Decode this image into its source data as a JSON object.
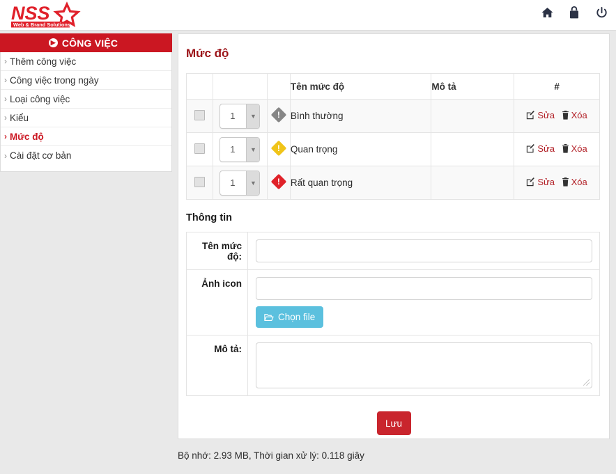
{
  "brand": {
    "name": "NSS",
    "tagline": "Web & Brand Solutions",
    "color": "#e0202a"
  },
  "topbar": {
    "icons": [
      {
        "name": "home-icon",
        "label": "Home"
      },
      {
        "name": "lock-icon",
        "label": "Lock"
      },
      {
        "name": "power-icon",
        "label": "Logout"
      }
    ]
  },
  "sidebar": {
    "header": "CÔNG VIỆC",
    "header_bg": "#cb1722",
    "items": [
      {
        "label": "Thêm công việc",
        "active": false
      },
      {
        "label": "Công việc trong ngày",
        "active": false
      },
      {
        "label": "Loại công việc",
        "active": false
      },
      {
        "label": "Kiểu",
        "active": false
      },
      {
        "label": "Mức độ",
        "active": true
      },
      {
        "label": "Cài đặt cơ bản",
        "active": false
      }
    ]
  },
  "main": {
    "title": "Mức độ",
    "title_color": "#9b1217",
    "table": {
      "headers": [
        "",
        "",
        "",
        "Tên mức độ",
        "Mô tả",
        "#"
      ],
      "rows": [
        {
          "order": "1",
          "icon_color": "#868686",
          "name": "Bình thường",
          "desc": "",
          "edit_label": "Sửa",
          "delete_label": "Xóa"
        },
        {
          "order": "1",
          "icon_color": "#f0c419",
          "name": "Quan trọng",
          "desc": "",
          "edit_label": "Sửa",
          "delete_label": "Xóa"
        },
        {
          "order": "1",
          "icon_color": "#e02229",
          "name": "Rất quan trọng",
          "desc": "",
          "edit_label": "Sửa",
          "delete_label": "Xóa"
        }
      ]
    },
    "form": {
      "section_title": "Thông tin",
      "name_label": "Tên mức độ:",
      "name_value": "",
      "icon_label": "Ảnh icon",
      "icon_value": "",
      "file_button": "Chọn file",
      "file_button_color": "#5bc0de",
      "desc_label": "Mô tả:",
      "desc_value": "",
      "save_label": "Lưu",
      "save_color": "#c9252d"
    }
  },
  "footer": {
    "status": "Bộ nhớ: 2.93 MB, Thời gian xử lý: 0.118 giây"
  }
}
